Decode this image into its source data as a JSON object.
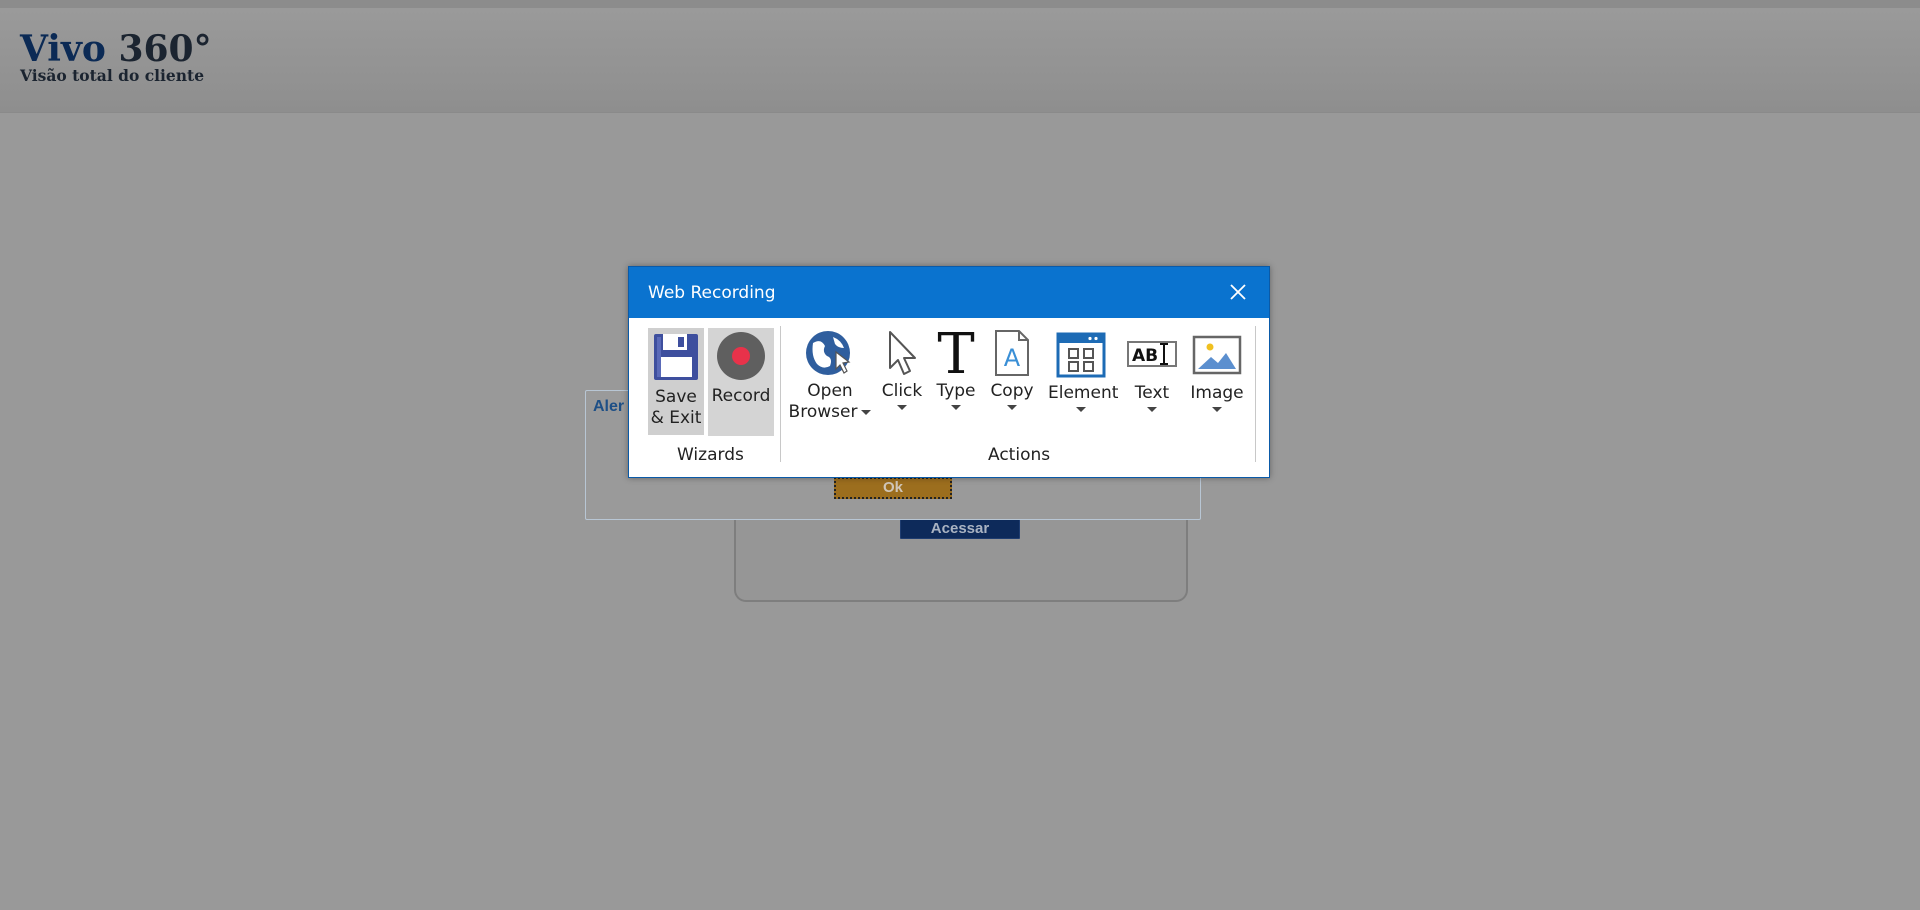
{
  "page": {
    "logo_brand": "Vivo",
    "logo_number": "360°",
    "logo_subtitle": "Visão total do cliente"
  },
  "login": {
    "access_button": "Acessar"
  },
  "alert": {
    "title": "Aler",
    "ok_button": "Ok"
  },
  "recorder": {
    "window_title": "Web Recording",
    "wizards": {
      "group_label": "Wizards",
      "items": [
        {
          "line1": "Save",
          "line2": "& Exit",
          "icon": "floppy-disk-icon"
        },
        {
          "line1": "Record",
          "icon": "record-icon",
          "selected": true
        }
      ]
    },
    "actions": {
      "group_label": "Actions",
      "items": [
        {
          "line1": "Open",
          "line2": "Browser",
          "icon": "globe-cursor-icon",
          "dropdown": true
        },
        {
          "line1": "Click",
          "icon": "mouse-pointer-icon",
          "dropdown": true
        },
        {
          "line1": "Type",
          "icon": "type-t-icon",
          "dropdown": true
        },
        {
          "line1": "Copy",
          "icon": "copy-document-icon",
          "dropdown": true
        },
        {
          "line1": "Element",
          "icon": "element-grid-icon",
          "dropdown": true
        },
        {
          "line1": "Text",
          "icon": "text-abi-icon",
          "dropdown": true
        },
        {
          "line1": "Image",
          "icon": "image-icon",
          "dropdown": true
        }
      ]
    },
    "colors": {
      "titlebar": "#0a73cf",
      "record_dot": "#e8324a"
    }
  }
}
